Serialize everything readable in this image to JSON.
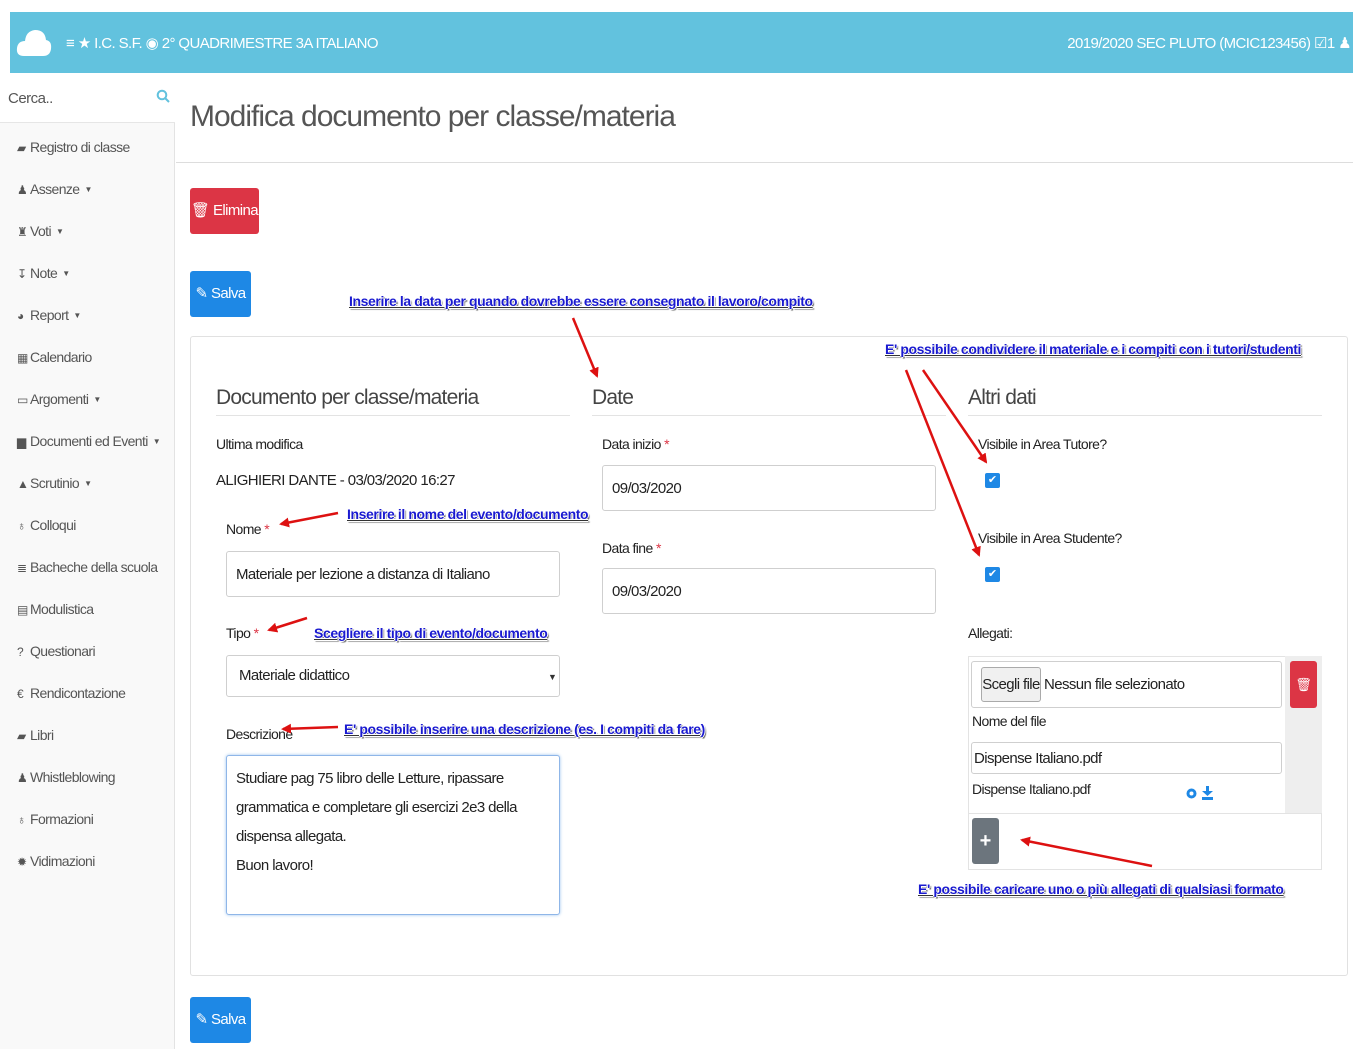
{
  "topbar": {
    "breadcrumb": "≡ ★ I.C. S.F. ◉ 2° QUADRIMESTRE  3A  ITALIANO",
    "right": "2019/2020  SEC PLUTO (MCIC123456) ☑1 ♟",
    "bg_color": "#62c2de"
  },
  "sidebar": {
    "search_placeholder": "Cerca..",
    "items": [
      {
        "label": "Registro di classe",
        "icon": "book-icon",
        "glyph": "▰",
        "caret": ""
      },
      {
        "label": "Assenze",
        "icon": "user-icon",
        "glyph": "♟",
        "caret": "▼"
      },
      {
        "label": "Voti",
        "icon": "bank-icon",
        "glyph": "♜",
        "caret": "▼"
      },
      {
        "label": "Note",
        "icon": "pin-icon",
        "glyph": "↧",
        "caret": "▼"
      },
      {
        "label": "Report",
        "icon": "chart-icon",
        "glyph": "◕",
        "caret": "▼"
      },
      {
        "label": "Calendario",
        "icon": "calendar-icon",
        "glyph": "▦",
        "caret": ""
      },
      {
        "label": "Argomenti",
        "icon": "folder-icon",
        "glyph": "▭",
        "caret": "▼"
      },
      {
        "label": "Documenti ed Eventi",
        "icon": "document-icon",
        "glyph": "▆",
        "caret": "▼"
      },
      {
        "label": "Scrutinio",
        "icon": "graduation-icon",
        "glyph": "▲",
        "caret": "▼"
      },
      {
        "label": "Colloqui",
        "icon": "chat-icon",
        "glyph": "♁",
        "caret": ""
      },
      {
        "label": "Bacheche della scuola",
        "icon": "list-icon",
        "glyph": "≣",
        "caret": ""
      },
      {
        "label": "Modulistica",
        "icon": "file-icon",
        "glyph": "▤",
        "caret": ""
      },
      {
        "label": "Questionari",
        "icon": "question-icon",
        "glyph": "?",
        "caret": ""
      },
      {
        "label": "Rendicontazione",
        "icon": "euro-icon",
        "glyph": "€",
        "caret": ""
      },
      {
        "label": "Libri",
        "icon": "book-icon",
        "glyph": "▰",
        "caret": ""
      },
      {
        "label": "Whistleblowing",
        "icon": "user-secret-icon",
        "glyph": "♟",
        "caret": ""
      },
      {
        "label": "Formazioni",
        "icon": "chat-icon",
        "glyph": "♁",
        "caret": ""
      },
      {
        "label": "Vidimazioni",
        "icon": "stamp-icon",
        "glyph": "✹",
        "caret": ""
      }
    ]
  },
  "page": {
    "title": "Modifica documento per classe/materia",
    "delete_label": "🗑 Elimina",
    "save_label": "✎ Salva",
    "delete_color": "#dc3545",
    "save_color": "#1e88e5"
  },
  "doc": {
    "section": "Documento per classe/materia",
    "last_mod_label": "Ultima modifica",
    "last_mod_value": "ALIGHIERI DANTE - 03/03/2020 16:27",
    "name_label": "Nome",
    "name_value": "Materiale per lezione a distanza di Italiano",
    "type_label": "Tipo",
    "type_value": "Materiale didattico",
    "desc_label": "Descrizione",
    "desc_value": "Studiare pag 75 libro delle Letture, ripassare grammatica e completare gli esercizi 2e3 della dispensa allegata.\nBuon lavoro!",
    "required_mark": "*"
  },
  "dates": {
    "section": "Date",
    "start_label": "Data inizio",
    "start_value": "09/03/2020",
    "end_label": "Data fine",
    "end_value": "09/03/2020"
  },
  "other": {
    "section": "Altri dati",
    "tutor_label": "Visibile in Area Tutore?",
    "tutor_checked": true,
    "student_label": "Visibile in Area Studente?",
    "student_checked": true,
    "attachments_label": "Allegati:",
    "choose_file": "Scegli file",
    "no_file": "Nessun file selezionato",
    "file_name_label": "Nome del file",
    "file_name_value": "Dispense Italiano.pdf",
    "existing_file": "Dispense Italiano.pdf",
    "checkmark": "✔",
    "plus": "+"
  },
  "annotations": {
    "date_note": "Inserire la data per quando dovrebbe essere consegnato il lavoro/compito",
    "share_note": "E' possibile condividere il materiale e i compiti con i tutori/studenti",
    "name_note": "Inserire il nome del evento/documento",
    "type_note": "Scegliere il tipo di evento/documento",
    "desc_note": "E' possibile inserire una descrizione (es. I compiti da fare)",
    "attach_note": "E' possibile caricare uno o più allegati di qualsiasi formato",
    "text_color": "#1a1ad0",
    "arrow_color": "#dd1111"
  }
}
